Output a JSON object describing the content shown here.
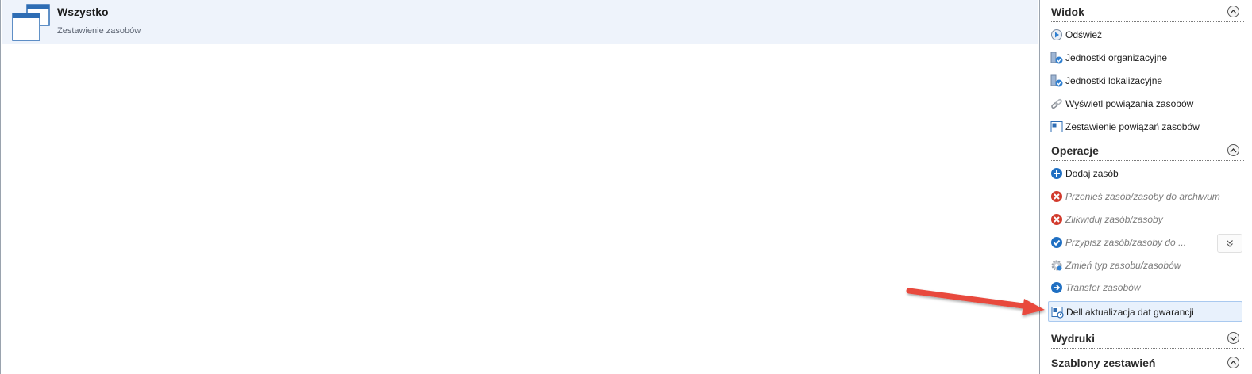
{
  "main": {
    "view": {
      "title": "Wszystko",
      "subtitle": "Zestawienie zasobów"
    }
  },
  "pane": {
    "sections": {
      "widok": {
        "title": "Widok",
        "items": [
          {
            "label": "Odśwież",
            "icon": "refresh-play-icon",
            "enabled": true
          },
          {
            "label": "Jednostki organizacyjne",
            "icon": "org-units-icon",
            "enabled": true
          },
          {
            "label": "Jednostki lokalizacyjne",
            "icon": "location-units-icon",
            "enabled": true
          },
          {
            "label": "Wyświetl powiązania zasobów",
            "icon": "link-icon",
            "enabled": true
          },
          {
            "label": "Zestawienie powiązań zasobów",
            "icon": "report-icon",
            "enabled": true
          }
        ]
      },
      "operacje": {
        "title": "Operacje",
        "items": [
          {
            "label": "Dodaj zasób",
            "icon": "add-icon",
            "enabled": true
          },
          {
            "label": "Przenieś zasób/zasoby do archiwum",
            "icon": "delete-icon",
            "enabled": false
          },
          {
            "label": "Zlikwiduj zasób/zasoby",
            "icon": "delete-icon",
            "enabled": false
          },
          {
            "label": "Przypisz zasób/zasoby do ...",
            "icon": "check-icon",
            "enabled": false
          },
          {
            "label": "Zmień typ zasobu/zasobów",
            "icon": "gear-icon",
            "enabled": false
          },
          {
            "label": "Transfer zasobów",
            "icon": "arrow-right-icon",
            "enabled": false
          },
          {
            "label": "Dell aktualizacja dat gwarancji",
            "icon": "dell-warranty-icon",
            "enabled": true,
            "highlighted": true
          }
        ]
      },
      "wydruki": {
        "title": "Wydruki",
        "collapsed": true
      },
      "szablony": {
        "title": "Szablony zestawień",
        "collapsed": false
      }
    }
  },
  "colors": {
    "accent_blue": "#1f6fc2",
    "delete_red": "#d23a2c",
    "selection_bg": "#eef3fb",
    "highlight_bg": "#e8f1fc",
    "annotation_arrow": "#e8483c"
  }
}
